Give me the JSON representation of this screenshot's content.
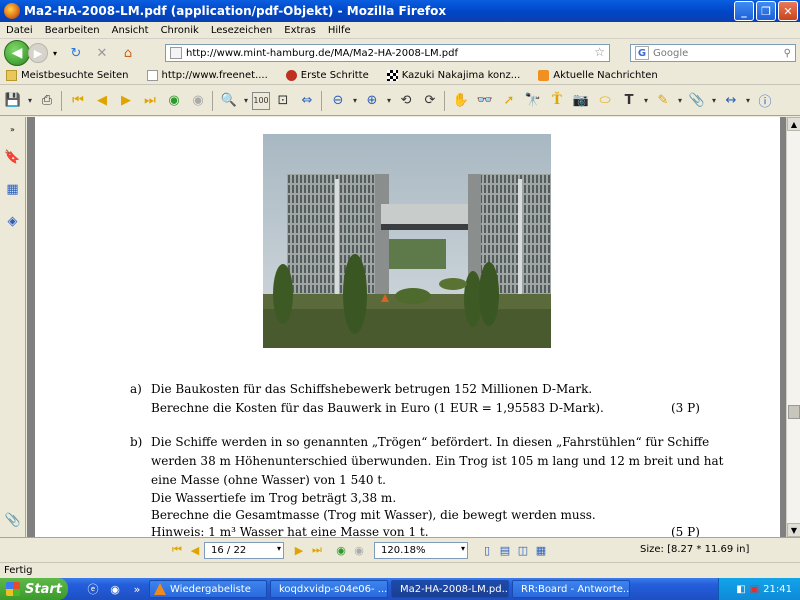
{
  "window": {
    "title": "Ma2-HA-2008-LM.pdf (application/pdf-Objekt) - Mozilla Firefox"
  },
  "menu": [
    "Datei",
    "Bearbeiten",
    "Ansicht",
    "Chronik",
    "Lesezeichen",
    "Extras",
    "Hilfe"
  ],
  "address": {
    "url": "http://www.mint-hamburg.de/MA/Ma2-HA-2008-LM.pdf"
  },
  "search": {
    "placeholder": "Google"
  },
  "bookmarks": [
    "Meistbesuchte Seiten",
    "http://www.freenet....",
    "Erste Schritte",
    "Kazuki Nakajima konz...",
    "Aktuelle Nachrichten"
  ],
  "pdf": {
    "lines": [
      {
        "label": "a)",
        "text": "Die Baukosten für das Schiffshebewerk betrugen 152 Millionen D-Mark."
      },
      {
        "text": "Berechne die Kosten für das Bauwerk in Euro (1 EUR = 1,95583 D-Mark).",
        "points": "(3 P)"
      },
      {
        "label": "b)",
        "text": "Die Schiffe werden in so genannten „Trögen“ befördert. In diesen „Fahrstühlen“ für Schiffe"
      },
      {
        "text": "werden 38 m Höhenunterschied überwunden. Ein Trog ist 105 m lang und 12 m breit und hat"
      },
      {
        "text": "eine Masse (ohne Wasser) von 1 540 t."
      },
      {
        "text": "Die Wassertiefe im Trog beträgt 3,38 m."
      },
      {
        "text": "Berechne die Gesamtmasse (Trog mit Wasser), die bewegt werden muss."
      },
      {
        "text": "Hinweis: 1 m³ Wasser hat eine Masse von 1 t.",
        "points": "(5 P)"
      }
    ]
  },
  "pdfnav": {
    "page": "16 / 22",
    "zoom": "120.18%",
    "size": "Size: [8.27 * 11.69 in]"
  },
  "status": "Fertig",
  "taskbar": {
    "start": "Start",
    "tasks": [
      "Wiedergabeliste",
      "koqdxvidp-s04e06- ...",
      "Ma2-HA-2008-LM.pd...",
      "RR:Board - Antworte..."
    ],
    "clock": "21:41"
  }
}
